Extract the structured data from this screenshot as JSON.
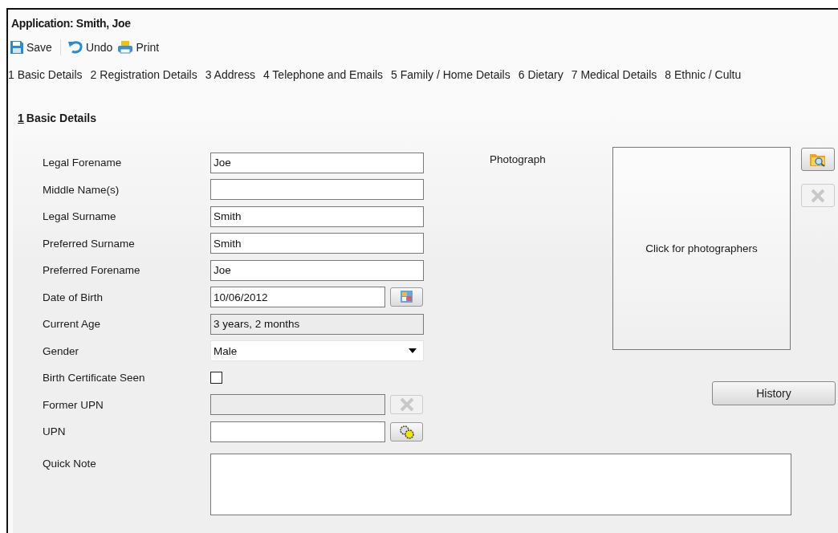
{
  "window": {
    "title": "Application: Smith, Joe"
  },
  "toolbar": [
    {
      "kind": "save",
      "label": "Save"
    },
    {
      "kind": "undo",
      "label": "Undo"
    },
    {
      "kind": "print",
      "label": "Print"
    }
  ],
  "tabs": [
    {
      "label": "1 Basic Details",
      "selected": false
    },
    {
      "label": "2 Registration Details",
      "selected": false
    },
    {
      "label": "3 Address",
      "selected": false
    },
    {
      "label": "4 Telephone and Emails",
      "selected": false
    },
    {
      "label": "5 Family / Home Details",
      "selected": false
    },
    {
      "label": "6 Dietary",
      "selected": false
    },
    {
      "label": "7 Medical Details",
      "selected": false
    },
    {
      "label": "8 Ethnic / Cultu",
      "selected": false
    }
  ],
  "section": {
    "number": "1",
    "title": "Basic Details"
  },
  "fields": [
    {
      "kind": "text",
      "label": "Legal Forename",
      "value": "Joe"
    },
    {
      "kind": "text",
      "label": "Middle Name(s)"
    },
    {
      "kind": "text",
      "label": "Legal Surname",
      "value": "Smith"
    },
    {
      "kind": "text",
      "label": "Preferred Surname",
      "value": "Smith"
    },
    {
      "kind": "text",
      "label": "Preferred Forename",
      "value": "Joe"
    },
    {
      "kind": "date",
      "label": "Date of Birth",
      "value": "10/06/2012"
    },
    {
      "kind": "readonly",
      "label": "Current Age",
      "value": "3 years, 2 months"
    },
    {
      "kind": "select",
      "label": "Gender",
      "value": "Male"
    },
    {
      "kind": "checkbox",
      "label": "Birth Certificate Seen",
      "checked": false
    },
    {
      "kind": "clearable",
      "label": "Former UPN",
      "disabled": true
    },
    {
      "kind": "generate",
      "label": "UPN"
    }
  ],
  "photo": {
    "label": "Photograph",
    "placeholder": "Click for photographers"
  },
  "history_button": "History",
  "quick_note": {
    "label": "Quick Note"
  }
}
